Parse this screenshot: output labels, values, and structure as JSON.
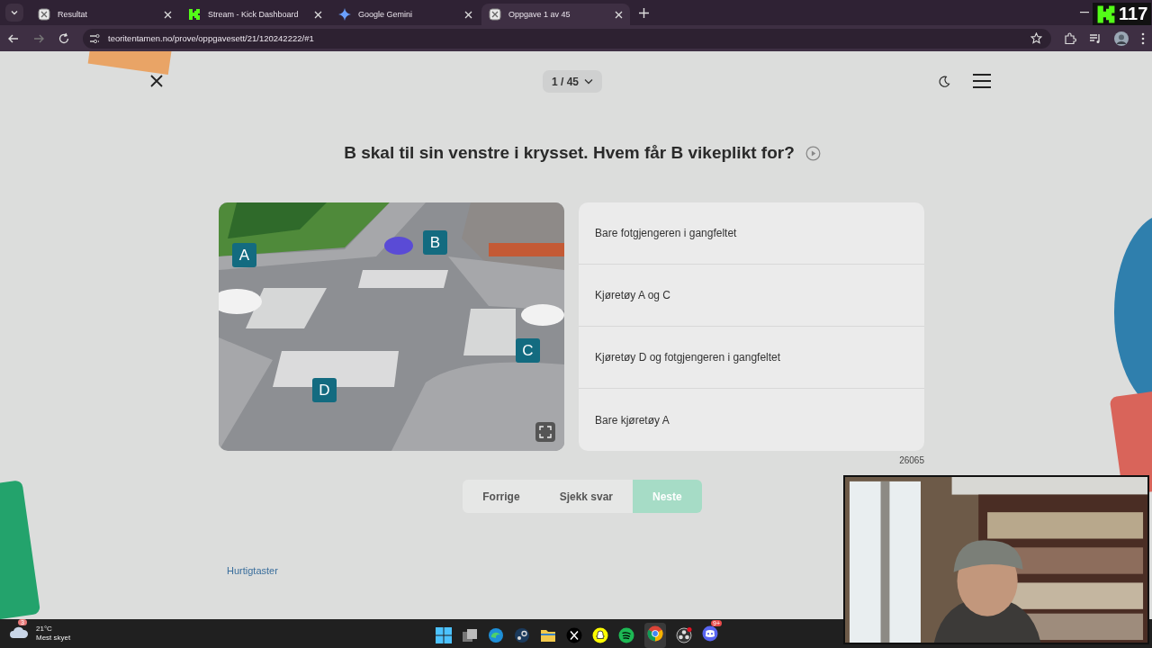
{
  "browser": {
    "tabs": [
      {
        "title": "Resultat",
        "selected": false,
        "kind": "site"
      },
      {
        "title": "Stream - Kick Dashboard",
        "selected": false,
        "kind": "kick"
      },
      {
        "title": "Google Gemini",
        "selected": false,
        "kind": "gemini"
      },
      {
        "title": "Oppgave 1 av 45",
        "selected": true,
        "kind": "site"
      }
    ],
    "url": "teoritentamen.no/prove/oppgavesett/21/120242222/#1"
  },
  "overlay_badge": {
    "count": "117"
  },
  "quiz": {
    "counter": "1 / 45",
    "question": "B skal til sin venstre i krysset. Hvem får B vikeplikt for?",
    "image_labels": [
      {
        "text": "A"
      },
      {
        "text": "B"
      },
      {
        "text": "C"
      },
      {
        "text": "D"
      }
    ],
    "answers": [
      {
        "text": "Bare fotgjengeren i gangfeltet"
      },
      {
        "text": "Kjøretøy A og C"
      },
      {
        "text": "Kjøretøy D og fotgjengeren i gangfeltet"
      },
      {
        "text": "Bare kjøretøy A"
      }
    ],
    "question_id": "26065",
    "buttons": [
      {
        "label": "Forrige",
        "kind": "plain"
      },
      {
        "label": "Sjekk svar",
        "kind": "plain"
      },
      {
        "label": "Neste",
        "kind": "primary"
      }
    ],
    "shortcuts_link": "Hurtigtaster"
  },
  "taskbar": {
    "weather": {
      "badge": "3",
      "temperature": "21°C",
      "condition": "Mest skyet"
    },
    "discord_badge": "9+"
  }
}
